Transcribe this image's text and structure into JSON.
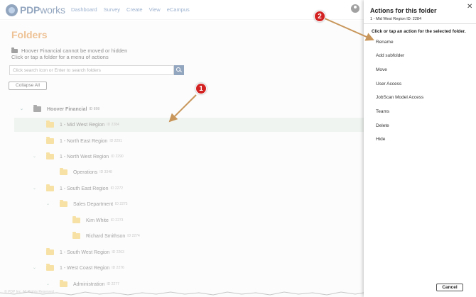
{
  "brand": {
    "logo_text_bold": "PDP",
    "logo_text_light": "works"
  },
  "nav": [
    "Dashboard",
    "Survey",
    "Create",
    "View",
    "eCampus"
  ],
  "user_initial": "C",
  "page": {
    "title": "Folders",
    "info_line1": "Hoover Financial cannot be moved or hidden",
    "info_line2": "Click or tap a folder for a menu of actions",
    "search_placeholder": "Click search icon or Enter to search folders",
    "collapse_label": "Collapse All"
  },
  "tree": [
    {
      "label": "Hoover Financial",
      "id": "ID 898"
    },
    {
      "label": "1 - Mid West Region",
      "id": "ID 2284"
    },
    {
      "label": "1 - North East Region",
      "id": "ID 2291"
    },
    {
      "label": "1 - North West Region",
      "id": "ID 2290"
    },
    {
      "label": "Operations",
      "id": "ID 3348"
    },
    {
      "label": "1 - South East Region",
      "id": "ID 2272"
    },
    {
      "label": "Sales Department",
      "id": "ID 2275"
    },
    {
      "label": "Kim White",
      "id": "ID 2273"
    },
    {
      "label": "Richard Smithson",
      "id": "ID 2274"
    },
    {
      "label": "1 - South West Region",
      "id": "ID 2263"
    },
    {
      "label": "1 - West Coast Region",
      "id": "ID 2276"
    },
    {
      "label": "Administration",
      "id": "ID 2277"
    }
  ],
  "footer_text": "© PDP Inc. All Rights Reserved",
  "panel": {
    "title": "Actions for this folder",
    "subtitle": "1 - Mid West Region ID: 2284",
    "instruction": "Click or tap an action for the selected folder.",
    "actions": [
      "Rename",
      "Add subfolder",
      "Move",
      "User Access",
      "JobScan Model Access",
      "Teams",
      "Delete",
      "Hide"
    ],
    "cancel_label": "Cancel",
    "close_glyph": "✕"
  },
  "callouts": {
    "one": "1",
    "two": "2"
  },
  "colors": {
    "brand": "#3b5d8a",
    "title": "#e0903f",
    "folder": "#f1c95a",
    "highlight": "#e4ece3",
    "callout": "#d32222",
    "arrow": "#c8965a"
  }
}
